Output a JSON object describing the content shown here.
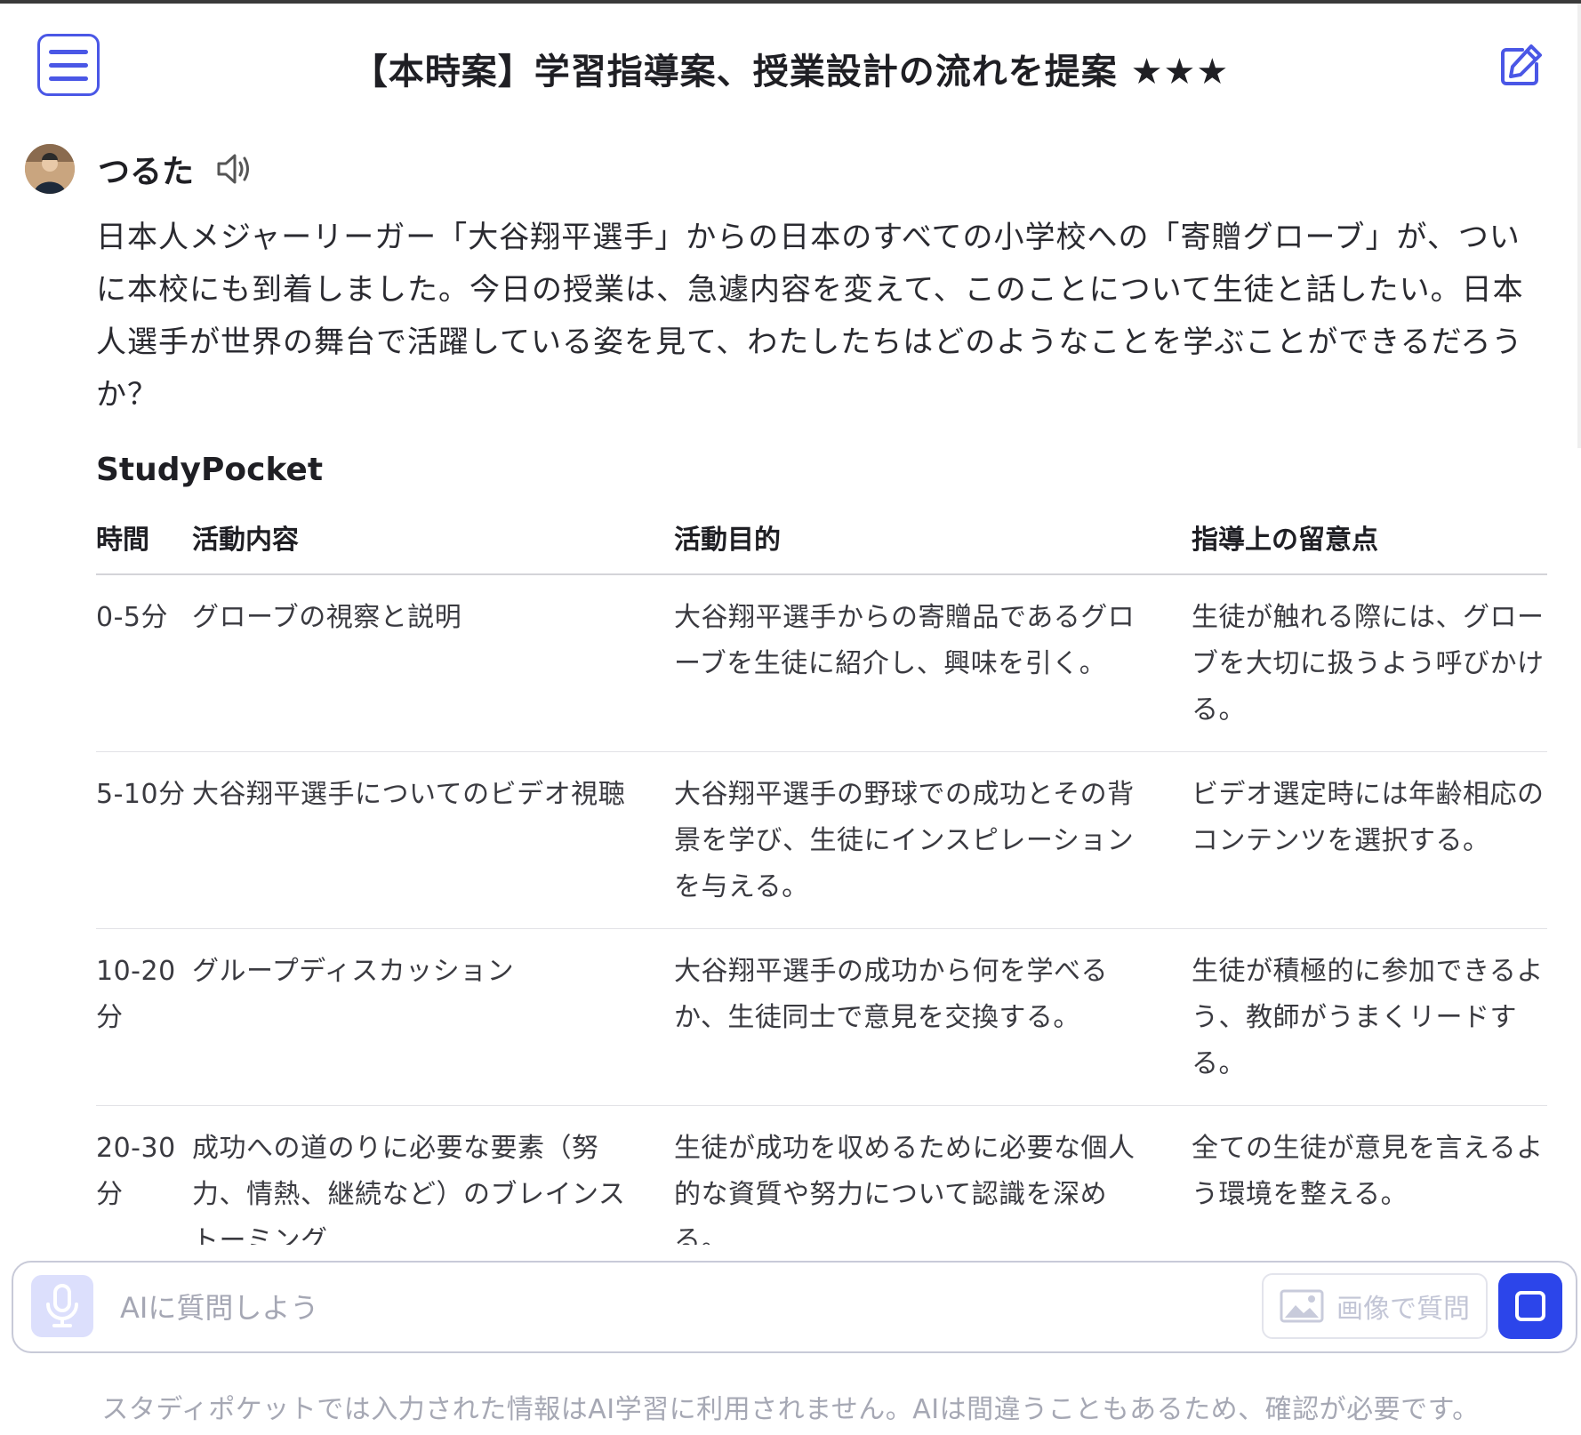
{
  "header": {
    "title": "【本時案】学習指導案、授業設計の流れを提案 ★★★"
  },
  "user": {
    "name": "つるた"
  },
  "question": "日本人メジャーリーガー「大谷翔平選手」からの日本のすべての小学校への「寄贈グローブ」が、ついに本校にも到着しました。今日の授業は、急遽内容を変えて、このことについて生徒と話したい。日本人選手が世界の舞台で活躍している姿を見て、わたしたちはどのようなことを学ぶことができるだろうか？",
  "bot": {
    "name": "StudyPocket"
  },
  "table": {
    "headers": [
      "時間",
      "活動内容",
      "活動目的",
      "指導上の留意点"
    ],
    "rows": [
      [
        "0-5分",
        "グローブの視察と説明",
        "大谷翔平選手からの寄贈品であるグローブを生徒に紹介し、興味を引く。",
        "生徒が触れる際には、グローブを大切に扱うよう呼びかける。"
      ],
      [
        "5-10分",
        "大谷翔平選手についてのビデオ視聴",
        "大谷翔平選手の野球での成功とその背景を学び、生徒にインスピレーションを与える。",
        "ビデオ選定時には年齢相応のコンテンツを選択する。"
      ],
      [
        "10-20分",
        "グループディスカッション",
        "大谷翔平選手の成功から何を学べるか、生徒同士で意見を交換する。",
        "生徒が積極的に参加できるよう、教師がうまくリードする。"
      ],
      [
        "20-30分",
        "成功への道のりに必要な要素（努力、情熱、継続など）のブレインストーミング",
        "生徒が成功を収めるために必要な個人的な資質や努力について認識を深める。",
        "全ての生徒が意見を言えるよう環境を整える。"
      ]
    ]
  },
  "input": {
    "placeholder": "AIに質問しよう",
    "image_button_label": "画像で質問"
  },
  "footer": {
    "disclaimer": "スタディポケットでは入力された情報はAI学習に利用されません。AIは間違うこともあるため、確認が必要です。"
  },
  "colors": {
    "accent": "#4a57e6",
    "send_button": "#2c45ea",
    "mic_button_bg": "#dcdffc",
    "muted_text": "#a6a8b4"
  },
  "icons": {
    "menu": "hamburger-menu-icon",
    "edit": "edit-pencil-icon",
    "speaker": "speaker-icon",
    "mic": "microphone-icon",
    "image": "image-icon",
    "stop": "stop-square-icon"
  }
}
